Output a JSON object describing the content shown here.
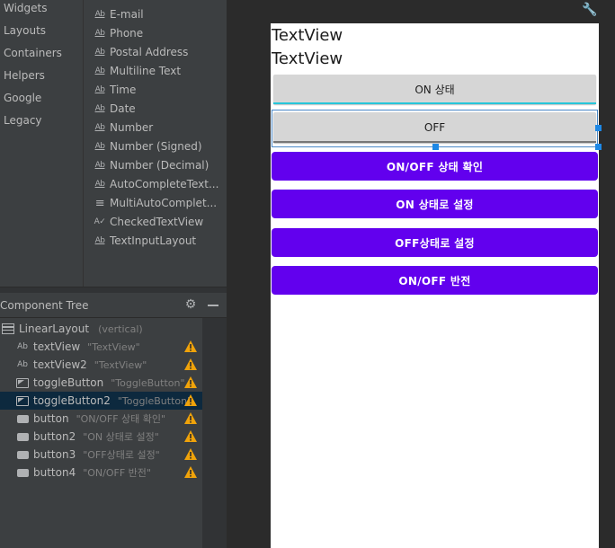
{
  "palette": {
    "categories": [
      "Widgets",
      "Layouts",
      "Containers",
      "Helpers",
      "Google",
      "Legacy"
    ],
    "items": [
      {
        "label": "E-mail",
        "icon": "Ab"
      },
      {
        "label": "Phone",
        "icon": "Ab"
      },
      {
        "label": "Postal Address",
        "icon": "Ab"
      },
      {
        "label": "Multiline Text",
        "icon": "Ab"
      },
      {
        "label": "Time",
        "icon": "Ab"
      },
      {
        "label": "Date",
        "icon": "Ab"
      },
      {
        "label": "Number",
        "icon": "Ab"
      },
      {
        "label": "Number (Signed)",
        "icon": "Ab"
      },
      {
        "label": "Number (Decimal)",
        "icon": "Ab"
      },
      {
        "label": "AutoCompleteText...",
        "icon": "Ab"
      },
      {
        "label": "MultiAutoComplet...",
        "icon": "≡"
      },
      {
        "label": "CheckedTextView",
        "icon": "A✓"
      },
      {
        "label": "TextInputLayout",
        "icon": "Ab"
      }
    ]
  },
  "component_tree": {
    "title": "Component Tree",
    "root": {
      "name": "LinearLayout",
      "attr": "(vertical)"
    },
    "rows": [
      {
        "name": "textView",
        "attr": "\"TextView\"",
        "icon": "Ab"
      },
      {
        "name": "textView2",
        "attr": "\"TextView\"",
        "icon": "Ab"
      },
      {
        "name": "toggleButton",
        "attr": "\"ToggleButton\"",
        "icon": "toggle"
      },
      {
        "name": "toggleButton2",
        "attr": "\"ToggleButton\"",
        "icon": "toggle"
      },
      {
        "name": "button",
        "attr": "\"ON/OFF 상태 확인\"",
        "icon": "button"
      },
      {
        "name": "button2",
        "attr": "\"ON 상태로 설정\"",
        "icon": "button"
      },
      {
        "name": "button3",
        "attr": "\"OFF상태로 설정\"",
        "icon": "button"
      },
      {
        "name": "button4",
        "attr": "\"ON/OFF 반전\"",
        "icon": "button"
      }
    ]
  },
  "preview": {
    "textview1": "TextView",
    "textview2": "TextView",
    "toggle1": "ON 상태",
    "toggle2": "OFF",
    "button1": "ON/OFF 상태 확인",
    "button2": "ON 상태로 설정",
    "button3": "OFF상태로 설정",
    "button4": "ON/OFF 반전"
  },
  "colors": {
    "accent_purple": "#6200ee",
    "toggle_on_indicator": "#26c6da",
    "warning": "#f0a30a",
    "selection": "#1e88e5"
  }
}
